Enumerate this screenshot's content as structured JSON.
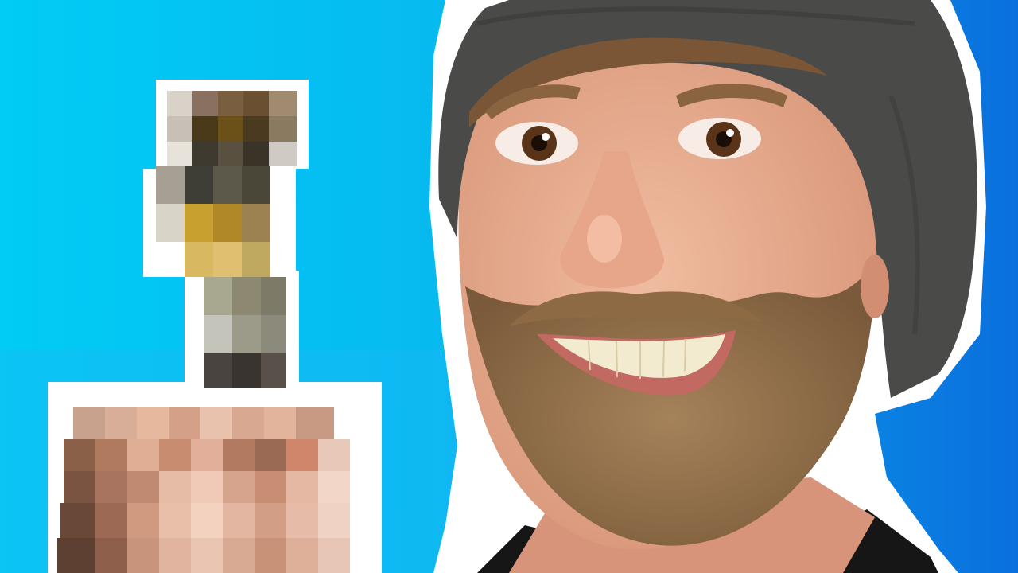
{
  "thumbnail": {
    "background": {
      "color_left": "#00CCF5",
      "color_right": "#0A6FDD"
    },
    "subject": {
      "description_icon": "smiling-man-icon",
      "beanie_color": "#4A4A48",
      "beard_color": "#8C6A45",
      "skin_color": "#E9AF92"
    },
    "censored_object": {
      "icon": "pixelated-object-icon",
      "outline_color": "#FFFFFF"
    }
  }
}
